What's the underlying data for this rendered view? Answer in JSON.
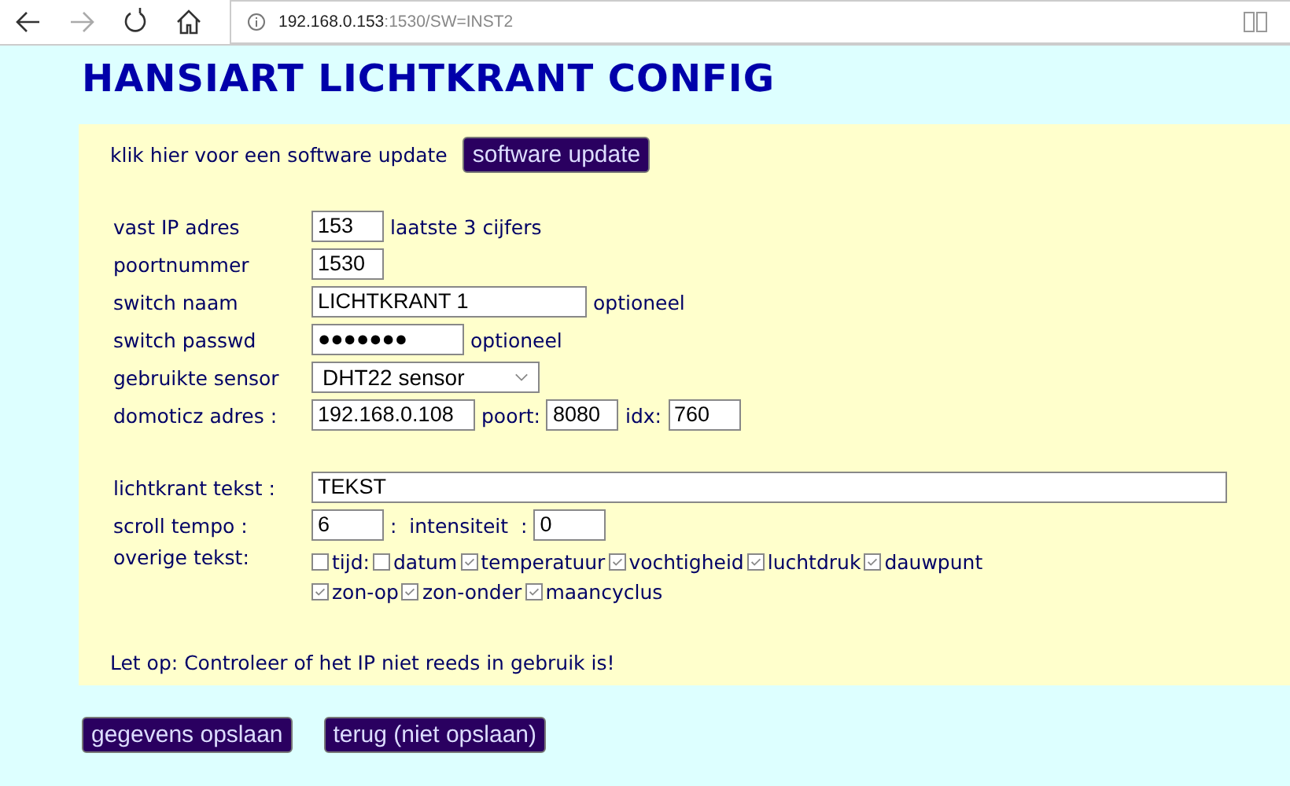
{
  "browser": {
    "url_host": "192.168.0.153",
    "url_rest": ":1530/SW=INST2"
  },
  "title": "HANSIART LICHTKRANT CONFIG",
  "update": {
    "text": "klik hier voor een software update",
    "button": "software update"
  },
  "rows": [
    {
      "label": "vast IP adres",
      "items": [
        {
          "kind": "input",
          "value": "153"
        },
        {
          "kind": "text",
          "value": "laatste 3 cijfers"
        }
      ]
    },
    {
      "label": "poortnummer",
      "items": [
        {
          "kind": "input",
          "value": "1530"
        }
      ]
    },
    {
      "label": "switch naam",
      "items": [
        {
          "kind": "input",
          "value": "LICHTKRANT 1"
        },
        {
          "kind": "text",
          "value": "optioneel"
        }
      ]
    },
    {
      "label": "switch passwd",
      "items": [
        {
          "kind": "input",
          "value": "●●●●●●●"
        },
        {
          "kind": "text",
          "value": "optioneel"
        }
      ]
    },
    {
      "label": "gebruikte sensor",
      "items": [
        {
          "kind": "select",
          "value": "DHT22 sensor"
        }
      ]
    },
    {
      "label": "domoticz adres :",
      "items": [
        {
          "kind": "input",
          "value": "192.168.0.108"
        },
        {
          "kind": "text",
          "value": "poort:"
        },
        {
          "kind": "input",
          "value": "8080"
        },
        {
          "kind": "text",
          "value": "idx:"
        },
        {
          "kind": "input",
          "value": "760"
        }
      ]
    }
  ],
  "rows2": [
    {
      "label": "lichtkrant tekst :",
      "items": [
        {
          "kind": "input",
          "value": "TEKST"
        }
      ]
    },
    {
      "label": "scroll tempo  :",
      "items": [
        {
          "kind": "input",
          "value": "6"
        },
        {
          "kind": "text",
          "value": ":  intensiteit  :"
        },
        {
          "kind": "input",
          "value": "0"
        }
      ]
    }
  ],
  "extra": {
    "label": "overige tekst:",
    "lines": [
      [
        {
          "label": "tijd:",
          "checked": false
        },
        {
          "label": "datum",
          "checked": false
        },
        {
          "label": "temperatuur",
          "checked": true
        },
        {
          "label": "vochtigheid",
          "checked": true
        },
        {
          "label": "luchtdruk",
          "checked": true
        },
        {
          "label": "dauwpunt",
          "checked": true
        }
      ],
      [
        {
          "label": "zon-op",
          "checked": true
        },
        {
          "label": "zon-onder",
          "checked": true
        },
        {
          "label": "maancyclus",
          "checked": true
        }
      ]
    ]
  },
  "note": "Let op: Controleer of het IP niet reeds in gebruik is!",
  "buttons": [
    "gegevens opslaan",
    "terug (niet opslaan)"
  ]
}
